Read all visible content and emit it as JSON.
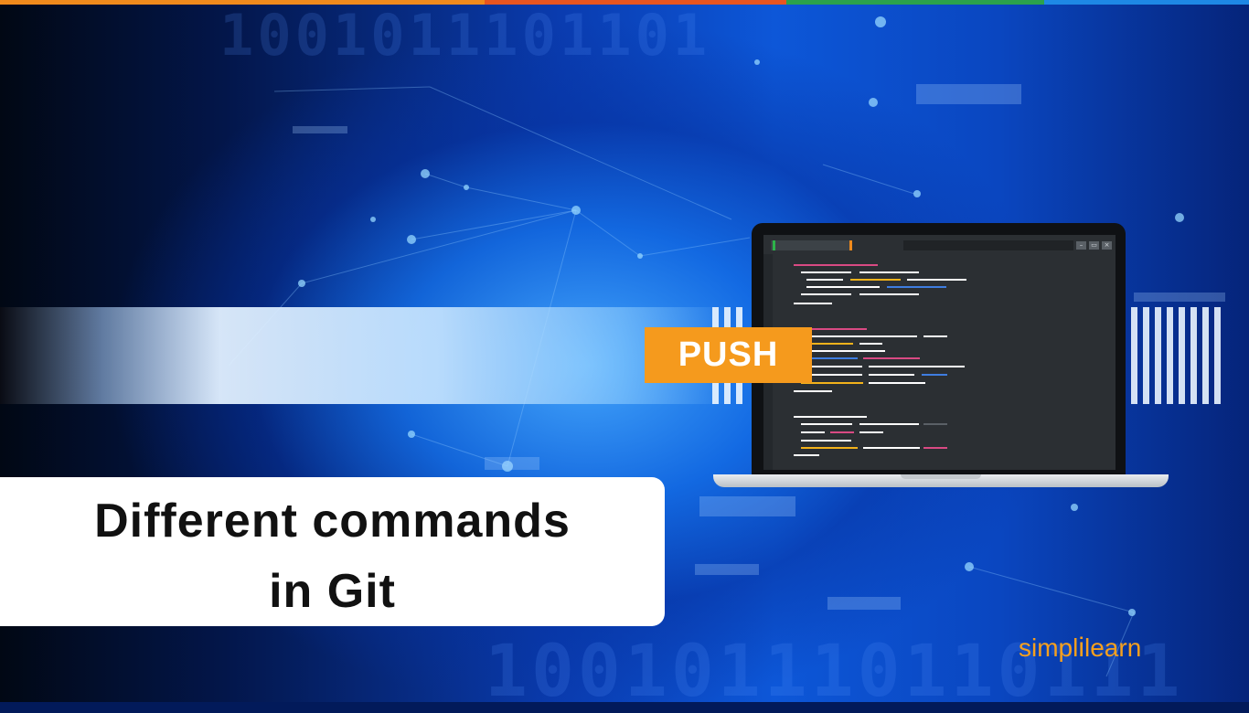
{
  "colors": {
    "push_badge": "#f59a1d",
    "brand": "#f6a01e",
    "title_text": "#111111",
    "title_box": "#ffffff",
    "top_stripe": [
      "#f08a1c",
      "#e8551f",
      "#2ba24c",
      "#1e88e5"
    ]
  },
  "binary": {
    "top": "1001011101101",
    "bottom": "100101110110111"
  },
  "laptop": {
    "window_buttons": [
      "–",
      "▭",
      "×"
    ]
  },
  "push_label": "PUSH",
  "title": {
    "line1": "Different commands",
    "line2": "in Git"
  },
  "brand": {
    "part1": "simpl",
    "separator": "i",
    "part2": "learn"
  }
}
